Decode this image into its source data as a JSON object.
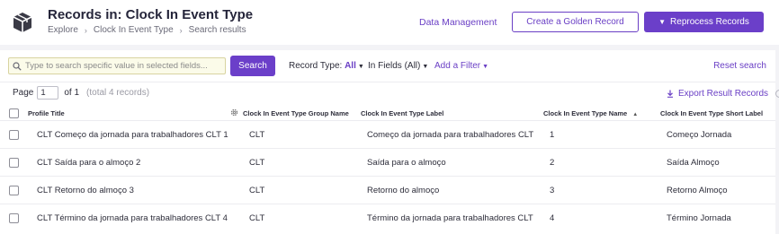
{
  "header": {
    "title": "Records in: Clock In Event Type",
    "breadcrumb": [
      "Explore",
      "Clock In Event Type",
      "Search results"
    ],
    "data_management_link": "Data Management",
    "create_golden_label": "Create a Golden Record",
    "reprocess_label": "Reprocess Records"
  },
  "toolbar": {
    "search_placeholder": "Type to search specific value in selected fields...",
    "search_button": "Search",
    "record_type_label": "Record Type:",
    "record_type_value": "All",
    "in_fields_label": "In Fields (All)",
    "add_filter_label": "Add a Filter",
    "reset_label": "Reset search"
  },
  "pagination": {
    "page_label": "Page",
    "page_value": "1",
    "of_label": "of",
    "total_pages": "1",
    "total_records": "(total 4 records)",
    "export_label": "Export Result Records"
  },
  "table": {
    "columns": [
      "Profile Title",
      "Clock In Event Type Group Name",
      "Clock In Event Type Label",
      "Clock In Event Type Name",
      "Clock In Event Type Short Label"
    ],
    "rows": [
      {
        "profile_title": "CLT Começo da jornada para trabalhadores CLT 1",
        "group_name": "CLT",
        "label": "Começo da jornada para trabalhadores CLT",
        "name": "1",
        "short_label": "Começo Jornada"
      },
      {
        "profile_title": "CLT Saída para o almoço 2",
        "group_name": "CLT",
        "label": "Saída para o almoço",
        "name": "2",
        "short_label": "Saída Almoço"
      },
      {
        "profile_title": "CLT Retorno do almoço 3",
        "group_name": "CLT",
        "label": "Retorno do almoço",
        "name": "3",
        "short_label": "Retorno Almoço"
      },
      {
        "profile_title": "CLT Término da jornada para trabalhadores CLT 4",
        "group_name": "CLT",
        "label": "Término da jornada para trabalhadores CLT",
        "name": "4",
        "short_label": "Término Jornada"
      }
    ]
  },
  "icons": {
    "logo": "box-icon",
    "search": "search-icon",
    "settings": "gear-icon",
    "export": "download-icon",
    "info": "info-icon",
    "sort": "sort-ascending-icon"
  },
  "colors": {
    "accent": "#6b3fc9",
    "page_background": "#f3f3f6",
    "search_field_background": "#fbfbe9"
  }
}
